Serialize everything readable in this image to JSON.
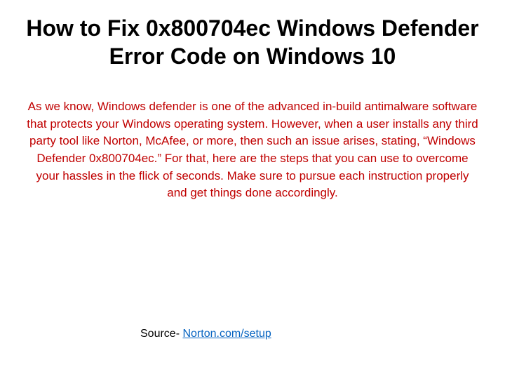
{
  "title": "How to Fix 0x800704ec Windows Defender Error Code on Windows 10",
  "body": "As we know, Windows defender is one of the advanced in-build antimalware software that protects your Windows operating system. However, when a user installs any third party tool like Norton, McAfee, or more, then such an issue arises, stating, “Windows Defender 0x800704ec.” For that, here are the steps that you can use to overcome your hassles in the flick of seconds. Make sure to pursue each instruction properly and get things done accordingly.",
  "source": {
    "label": "Source- ",
    "link_text": "Norton.com/setup"
  }
}
